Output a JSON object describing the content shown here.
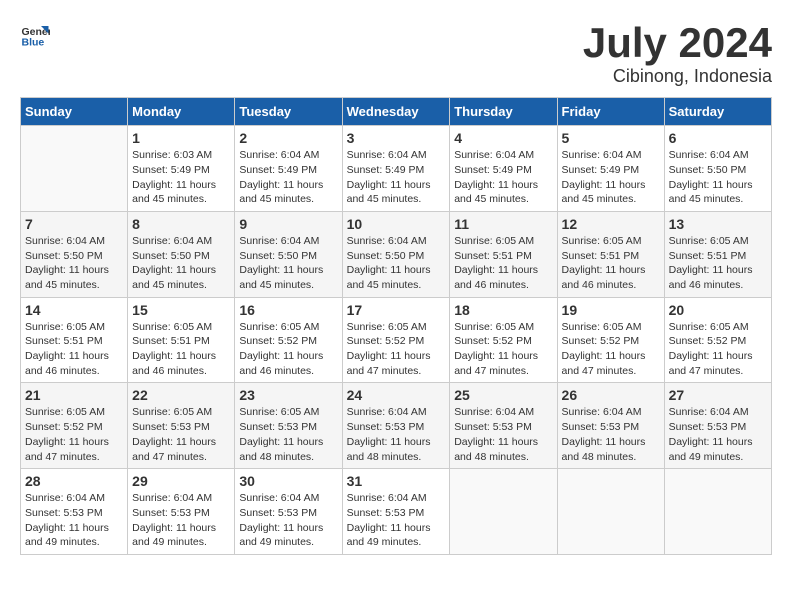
{
  "logo": {
    "text_general": "General",
    "text_blue": "Blue"
  },
  "title": {
    "month_year": "July 2024",
    "location": "Cibinong, Indonesia"
  },
  "days_of_week": [
    "Sunday",
    "Monday",
    "Tuesday",
    "Wednesday",
    "Thursday",
    "Friday",
    "Saturday"
  ],
  "weeks": [
    [
      {
        "day": "",
        "info": ""
      },
      {
        "day": "1",
        "info": "Sunrise: 6:03 AM\nSunset: 5:49 PM\nDaylight: 11 hours\nand 45 minutes."
      },
      {
        "day": "2",
        "info": "Sunrise: 6:04 AM\nSunset: 5:49 PM\nDaylight: 11 hours\nand 45 minutes."
      },
      {
        "day": "3",
        "info": "Sunrise: 6:04 AM\nSunset: 5:49 PM\nDaylight: 11 hours\nand 45 minutes."
      },
      {
        "day": "4",
        "info": "Sunrise: 6:04 AM\nSunset: 5:49 PM\nDaylight: 11 hours\nand 45 minutes."
      },
      {
        "day": "5",
        "info": "Sunrise: 6:04 AM\nSunset: 5:49 PM\nDaylight: 11 hours\nand 45 minutes."
      },
      {
        "day": "6",
        "info": "Sunrise: 6:04 AM\nSunset: 5:50 PM\nDaylight: 11 hours\nand 45 minutes."
      }
    ],
    [
      {
        "day": "7",
        "info": "Sunrise: 6:04 AM\nSunset: 5:50 PM\nDaylight: 11 hours\nand 45 minutes."
      },
      {
        "day": "8",
        "info": "Sunrise: 6:04 AM\nSunset: 5:50 PM\nDaylight: 11 hours\nand 45 minutes."
      },
      {
        "day": "9",
        "info": "Sunrise: 6:04 AM\nSunset: 5:50 PM\nDaylight: 11 hours\nand 45 minutes."
      },
      {
        "day": "10",
        "info": "Sunrise: 6:04 AM\nSunset: 5:50 PM\nDaylight: 11 hours\nand 45 minutes."
      },
      {
        "day": "11",
        "info": "Sunrise: 6:05 AM\nSunset: 5:51 PM\nDaylight: 11 hours\nand 46 minutes."
      },
      {
        "day": "12",
        "info": "Sunrise: 6:05 AM\nSunset: 5:51 PM\nDaylight: 11 hours\nand 46 minutes."
      },
      {
        "day": "13",
        "info": "Sunrise: 6:05 AM\nSunset: 5:51 PM\nDaylight: 11 hours\nand 46 minutes."
      }
    ],
    [
      {
        "day": "14",
        "info": "Sunrise: 6:05 AM\nSunset: 5:51 PM\nDaylight: 11 hours\nand 46 minutes."
      },
      {
        "day": "15",
        "info": "Sunrise: 6:05 AM\nSunset: 5:51 PM\nDaylight: 11 hours\nand 46 minutes."
      },
      {
        "day": "16",
        "info": "Sunrise: 6:05 AM\nSunset: 5:52 PM\nDaylight: 11 hours\nand 46 minutes."
      },
      {
        "day": "17",
        "info": "Sunrise: 6:05 AM\nSunset: 5:52 PM\nDaylight: 11 hours\nand 47 minutes."
      },
      {
        "day": "18",
        "info": "Sunrise: 6:05 AM\nSunset: 5:52 PM\nDaylight: 11 hours\nand 47 minutes."
      },
      {
        "day": "19",
        "info": "Sunrise: 6:05 AM\nSunset: 5:52 PM\nDaylight: 11 hours\nand 47 minutes."
      },
      {
        "day": "20",
        "info": "Sunrise: 6:05 AM\nSunset: 5:52 PM\nDaylight: 11 hours\nand 47 minutes."
      }
    ],
    [
      {
        "day": "21",
        "info": "Sunrise: 6:05 AM\nSunset: 5:52 PM\nDaylight: 11 hours\nand 47 minutes."
      },
      {
        "day": "22",
        "info": "Sunrise: 6:05 AM\nSunset: 5:53 PM\nDaylight: 11 hours\nand 47 minutes."
      },
      {
        "day": "23",
        "info": "Sunrise: 6:05 AM\nSunset: 5:53 PM\nDaylight: 11 hours\nand 48 minutes."
      },
      {
        "day": "24",
        "info": "Sunrise: 6:04 AM\nSunset: 5:53 PM\nDaylight: 11 hours\nand 48 minutes."
      },
      {
        "day": "25",
        "info": "Sunrise: 6:04 AM\nSunset: 5:53 PM\nDaylight: 11 hours\nand 48 minutes."
      },
      {
        "day": "26",
        "info": "Sunrise: 6:04 AM\nSunset: 5:53 PM\nDaylight: 11 hours\nand 48 minutes."
      },
      {
        "day": "27",
        "info": "Sunrise: 6:04 AM\nSunset: 5:53 PM\nDaylight: 11 hours\nand 49 minutes."
      }
    ],
    [
      {
        "day": "28",
        "info": "Sunrise: 6:04 AM\nSunset: 5:53 PM\nDaylight: 11 hours\nand 49 minutes."
      },
      {
        "day": "29",
        "info": "Sunrise: 6:04 AM\nSunset: 5:53 PM\nDaylight: 11 hours\nand 49 minutes."
      },
      {
        "day": "30",
        "info": "Sunrise: 6:04 AM\nSunset: 5:53 PM\nDaylight: 11 hours\nand 49 minutes."
      },
      {
        "day": "31",
        "info": "Sunrise: 6:04 AM\nSunset: 5:53 PM\nDaylight: 11 hours\nand 49 minutes."
      },
      {
        "day": "",
        "info": ""
      },
      {
        "day": "",
        "info": ""
      },
      {
        "day": "",
        "info": ""
      }
    ]
  ]
}
